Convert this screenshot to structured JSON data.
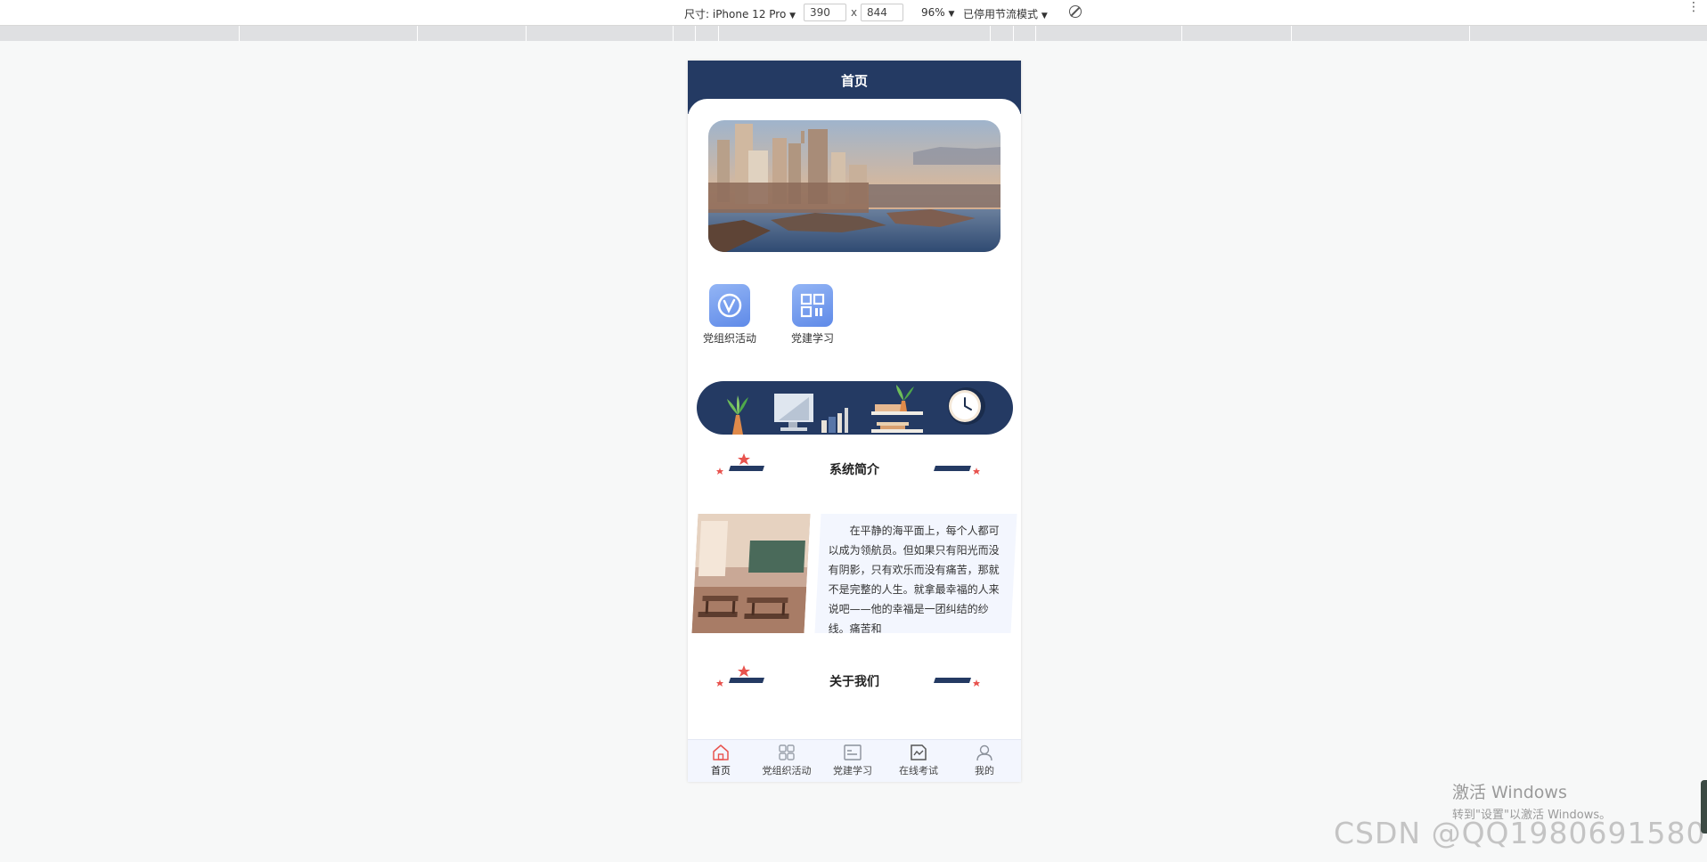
{
  "devtools": {
    "size_label": "尺寸: iPhone 12 Pro",
    "dropdown_glyph": "▼",
    "width": "390",
    "times": "x",
    "height": "844",
    "zoom": "96%",
    "throttle": "已停用节流模式",
    "menu_glyph": "⋮"
  },
  "app": {
    "nav_title": "首页",
    "entries": [
      {
        "label": "党组织活动",
        "icon": "v-circle-icon"
      },
      {
        "label": "党建学习",
        "icon": "qr-grid-icon"
      }
    ],
    "intro": {
      "title": "系统简介",
      "text": "在平静的海平面上，每个人都可以成为领航员。但如果只有阳光而没有阴影，只有欢乐而没有痛苦，那就不是完整的人生。就拿最幸福的人来说吧——他的幸福是一团纠结的纱线。痛苦和"
    },
    "about": {
      "title": "关于我们"
    },
    "tabs": [
      {
        "label": "首页",
        "icon": "home-icon",
        "active": true
      },
      {
        "label": "党组织活动",
        "icon": "grid-icon",
        "active": false
      },
      {
        "label": "党建学习",
        "icon": "board-icon",
        "active": false
      },
      {
        "label": "在线考试",
        "icon": "exam-icon",
        "active": false
      },
      {
        "label": "我的",
        "icon": "user-icon",
        "active": false
      }
    ]
  },
  "watermark": {
    "windows_line1": "激活 Windows",
    "windows_line2": "转到\"设置\"以激活 Windows。",
    "csdn": "CSDN @QQ1980691580"
  },
  "colors": {
    "nav": "#243a63",
    "accent_star": "#e8534e",
    "tab_bg": "#f3f6fe"
  }
}
